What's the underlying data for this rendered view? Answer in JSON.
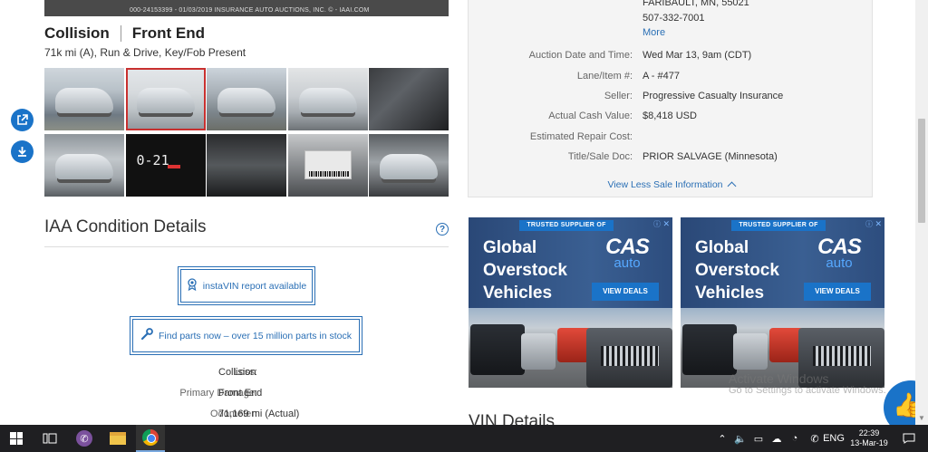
{
  "hero_caption": "000-24153399 - 01/03/2019 INSURANCE AUTO AUCTIONS, INC. © - IAAI.COM",
  "vehicle": {
    "loss_title": "Collision",
    "damage_title": "Front End",
    "subtitle": "71k mi (A), Run & Drive, Key/Fob Present"
  },
  "thumbnails": [
    {
      "name": "thumb-1"
    },
    {
      "name": "thumb-2",
      "selected": true
    },
    {
      "name": "thumb-3"
    },
    {
      "name": "thumb-4"
    },
    {
      "name": "thumb-5"
    },
    {
      "name": "thumb-6"
    },
    {
      "name": "thumb-7",
      "dash_text": "0-21"
    },
    {
      "name": "thumb-8"
    },
    {
      "name": "thumb-9"
    },
    {
      "name": "thumb-10"
    }
  ],
  "side_icons": [
    "open-external-icon",
    "download-icon"
  ],
  "condition": {
    "heading": "IAA Condition Details",
    "help_glyph": "?",
    "instavin_label": "instaVIN report available",
    "parts_label": "Find parts now – over 15 million parts in stock",
    "rows": [
      {
        "label": "Loss:",
        "value": "Collision"
      },
      {
        "label": "Primary Damage:",
        "value": "Front End"
      },
      {
        "label": "Odometer:",
        "value": "71,169 mi (Actual)"
      }
    ]
  },
  "seller_info": {
    "address_city": "FARIBAULT, MN, 55021",
    "phone": "507-332-7001",
    "more_label": "More",
    "rows": [
      {
        "label": "Auction Date and Time:",
        "value": "Wed Mar 13, 9am (CDT)"
      },
      {
        "label": "Lane/Item #:",
        "value": "A - #477"
      },
      {
        "label": "Seller:",
        "value": "Progressive Casualty Insurance"
      },
      {
        "label": "Actual Cash Value:",
        "value": "$8,418 USD"
      },
      {
        "label": "Estimated Repair Cost:",
        "value": ""
      },
      {
        "label": "Title/Sale Doc:",
        "value": "PRIOR SALVAGE (Minnesota)"
      }
    ],
    "view_less_label": "View Less Sale Information"
  },
  "ads": [
    {
      "ribbon": "TRUSTED SUPPLIER OF",
      "headline": "Global Overstock Vehicles",
      "brand": "CAS",
      "brand_sub": "auto",
      "cta": "VIEW DEALS"
    },
    {
      "ribbon": "TRUSTED SUPPLIER OF",
      "headline": "Global Overstock Vehicles",
      "brand": "CAS",
      "brand_sub": "auto",
      "cta": "VIEW DEALS"
    }
  ],
  "vin_heading": "VIN Details",
  "windows_watermark": {
    "line1": "Activate Windows",
    "line2": "Go to Settings to activate Windows."
  },
  "taskbar": {
    "time": "22:39",
    "date": "13-Mar-19",
    "lang": "ENG"
  },
  "colors": {
    "accent": "#2a6fb5",
    "selected_thumb": "#c8302f",
    "ad_blue": "#1a73c8"
  }
}
